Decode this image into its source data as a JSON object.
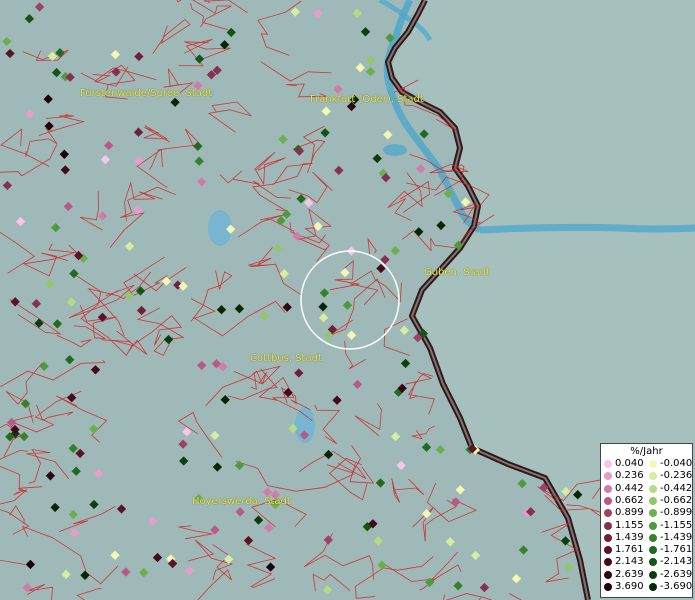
{
  "map": {
    "labels": [
      {
        "id": "fuerstenwalde",
        "text": "Fürstenwalde/Spree, Stadt"
      },
      {
        "id": "frankfurt",
        "text": "Frankfurt (Oder), Stadt"
      },
      {
        "id": "guben",
        "text": "Guben, Stadt"
      },
      {
        "id": "cottbus",
        "text": "Cottbus, Stadt"
      },
      {
        "id": "hoyerswerda",
        "text": "Hoyerswerda, Stadt"
      }
    ],
    "colors": {
      "land": "#9fb9b8",
      "poland": "#a8c2c0",
      "river": "#4aa6cc",
      "border": "#2a1a1a",
      "admin_lines": "#d42020",
      "highlight_circle": "#ffffff"
    }
  },
  "legend": {
    "title": "%/Jahr",
    "positive": [
      {
        "value": "0.040",
        "color": "#f5c6ea"
      },
      {
        "value": "0.236",
        "color": "#e79ccc"
      },
      {
        "value": "0.442",
        "color": "#d07ca8"
      },
      {
        "value": "0.662",
        "color": "#b85a87"
      },
      {
        "value": "0.899",
        "color": "#9e4068"
      },
      {
        "value": "1.155",
        "color": "#873050"
      },
      {
        "value": "1.439",
        "color": "#70203c"
      },
      {
        "value": "1.761",
        "color": "#5a1429"
      },
      {
        "value": "2.143",
        "color": "#430c1c"
      },
      {
        "value": "2.639",
        "color": "#300612"
      },
      {
        "value": "3.690",
        "color": "#1e020a"
      }
    ],
    "negative": [
      {
        "value": "-0.040",
        "color": "#f4f7b5"
      },
      {
        "value": "-0.236",
        "color": "#d6eca0"
      },
      {
        "value": "-0.442",
        "color": "#b4dc86"
      },
      {
        "value": "-0.662",
        "color": "#90c86a"
      },
      {
        "value": "-0.899",
        "color": "#6cb04e"
      },
      {
        "value": "-1.155",
        "color": "#4e9a3c"
      },
      {
        "value": "-1.439",
        "color": "#36822c"
      },
      {
        "value": "-1.761",
        "color": "#226a20"
      },
      {
        "value": "-2.143",
        "color": "#145416"
      },
      {
        "value": "-2.639",
        "color": "#0b3e0e"
      },
      {
        "value": "-3.690",
        "color": "#042806"
      }
    ]
  }
}
